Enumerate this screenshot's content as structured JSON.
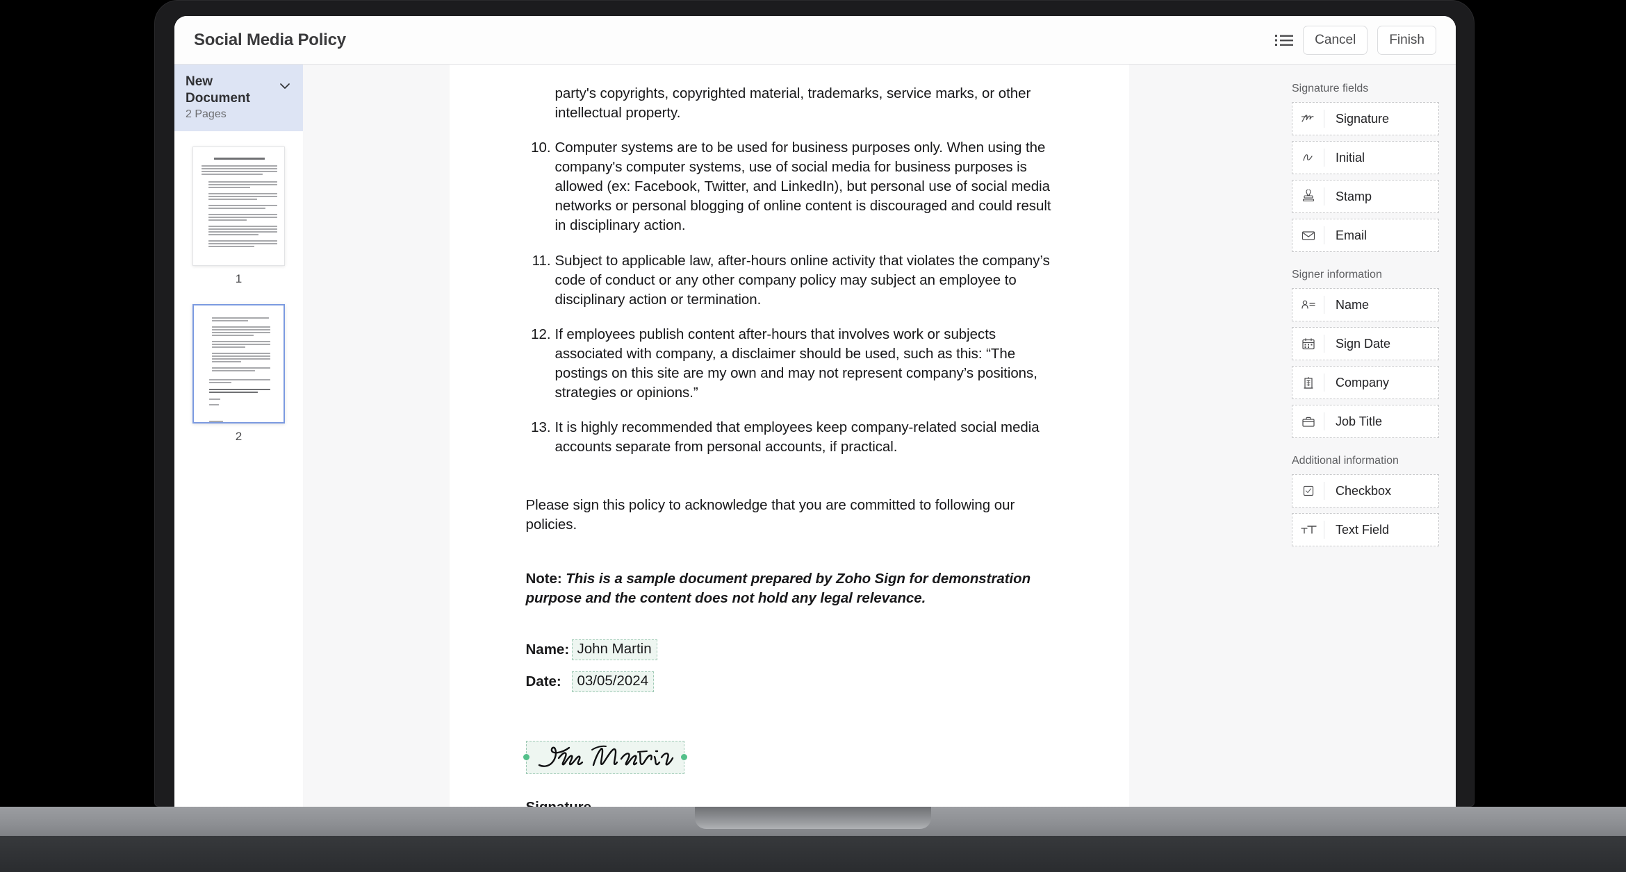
{
  "header": {
    "title": "Social Media Policy",
    "list_icon": "list-icon",
    "cancel_label": "Cancel",
    "finish_label": "Finish"
  },
  "thumbnails_pane": {
    "document_name": "New Document",
    "page_count_label": "2 Pages",
    "chevron_icon": "chevron-down-icon",
    "pages": [
      {
        "label": "1",
        "selected": false,
        "thumb_title": "Sample Social Media Policy"
      },
      {
        "label": "2",
        "selected": true,
        "thumb_title": ""
      }
    ]
  },
  "document": {
    "continued_paragraph": "party's copyrights, copyrighted material, trademarks, service marks, or other intellectual property.",
    "items": [
      {
        "number": "10.",
        "text": "Computer systems are to be used for business purposes only. When using the company's computer systems, use of social media for business purposes is allowed (ex: Facebook, Twitter, and LinkedIn), but personal use of social media networks or personal blogging of online content is discouraged and could result in disciplinary action."
      },
      {
        "number": "11.",
        "text": "Subject to applicable law, after-hours online activity that violates the company’s code of conduct or any other company policy may subject an employee to disciplinary action or termination."
      },
      {
        "number": "12.",
        "text": "If employees publish content after-hours that involves work or subjects associated with company, a disclaimer should be used, such as this: “The postings on this site are my own and may not represent company’s positions, strategies or opinions.”"
      },
      {
        "number": "13.",
        "text": "It is highly recommended that employees keep company-related social media accounts separate from personal accounts, if practical."
      }
    ],
    "closing_paragraph": "Please sign this policy to acknowledge that you are committed to following our policies.",
    "note_prefix": "Note:",
    "note_body": "This is a sample document prepared by Zoho Sign for demonstration purpose and the content does not hold any legal relevance.",
    "name_label": "Name:",
    "name_value": "John Martin",
    "date_label": "Date:",
    "date_value": "03/05/2024",
    "signature_value": "John Martin",
    "signature_caption": "Signature"
  },
  "fields_pane": {
    "groups": [
      {
        "title": "Signature fields",
        "items": [
          {
            "label": "Signature",
            "icon": "signature-icon"
          },
          {
            "label": "Initial",
            "icon": "initial-icon"
          },
          {
            "label": "Stamp",
            "icon": "stamp-icon"
          },
          {
            "label": "Email",
            "icon": "envelope-icon"
          }
        ]
      },
      {
        "title": "Signer information",
        "items": [
          {
            "label": "Name",
            "icon": "person-lines-icon"
          },
          {
            "label": "Sign Date",
            "icon": "calendar-icon"
          },
          {
            "label": "Company",
            "icon": "building-icon"
          },
          {
            "label": "Job Title",
            "icon": "briefcase-icon"
          }
        ]
      },
      {
        "title": "Additional information",
        "items": [
          {
            "label": "Checkbox",
            "icon": "checkbox-icon"
          },
          {
            "label": "Text Field",
            "icon": "text-field-icon"
          }
        ]
      }
    ]
  },
  "colors": {
    "accent_blue": "#dde4f4",
    "selected_page_border": "#7b9ae0",
    "field_fill_green": "#eef6f1",
    "field_handle_green": "#53c08a",
    "viewer_bg": "#f7f7f8"
  }
}
